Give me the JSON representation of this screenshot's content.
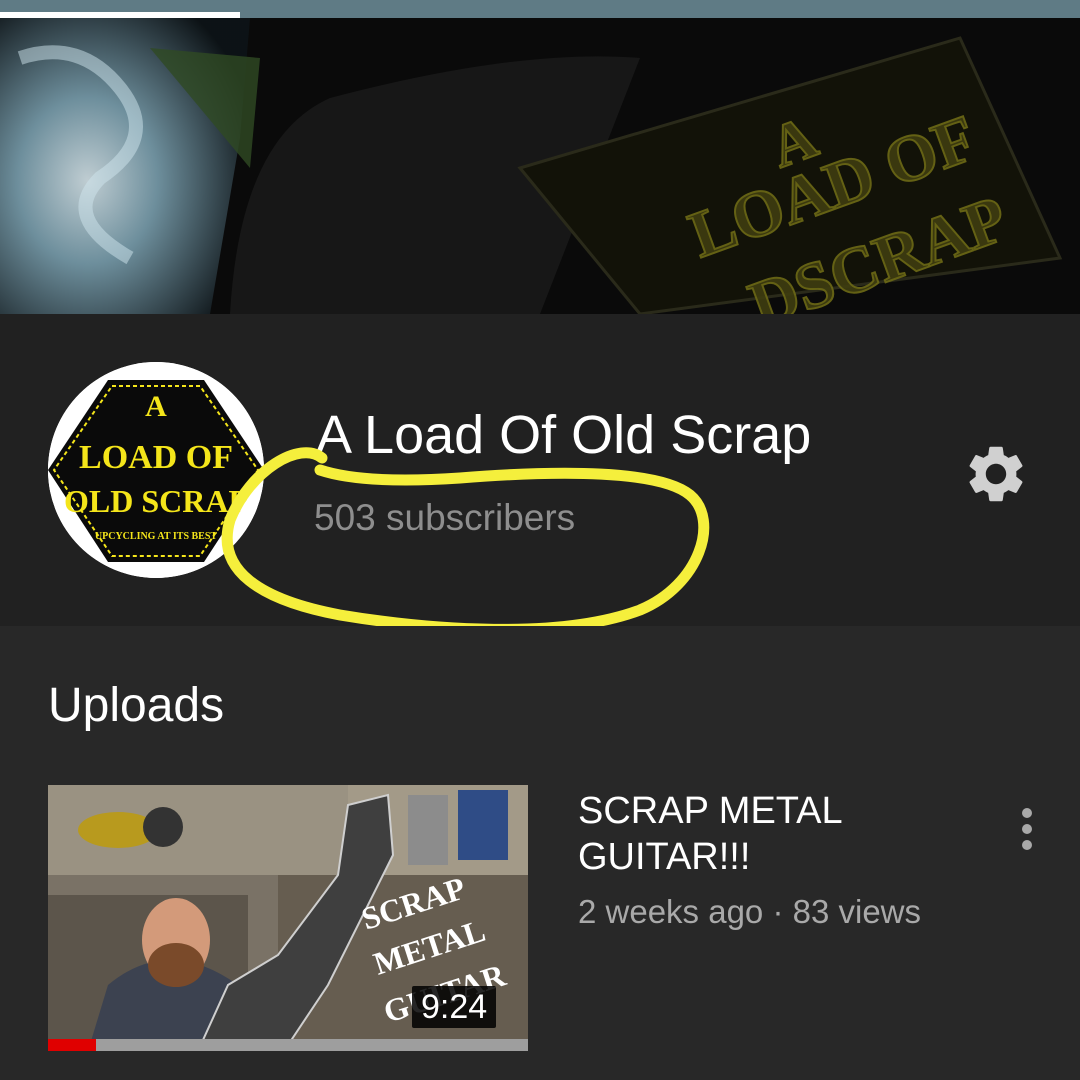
{
  "channel": {
    "name": "A Load Of Old Scrap",
    "subscribers": "503 subscribers",
    "logo_text": [
      "A",
      "LOAD OF",
      "OLD SCRAP",
      "UPCYCLING AT ITS BEST"
    ]
  },
  "uploads": {
    "title": "Uploads",
    "videos": [
      {
        "title": "SCRAP METAL GUITAR!!!",
        "meta": "2 weeks ago · 83 views",
        "duration": "9:24",
        "thumb_text": [
          "SCRAP",
          "METAL",
          "GUITAR"
        ],
        "watched_fraction": 0.1
      }
    ]
  },
  "icons": {
    "settings": "gear-icon",
    "more": "more-vert-icon"
  },
  "colors": {
    "background": "#282828",
    "channel_header": "#212121",
    "highlight": "#f5ef3c",
    "progress": "#e00000",
    "tab_bar": "#5f7b85"
  }
}
